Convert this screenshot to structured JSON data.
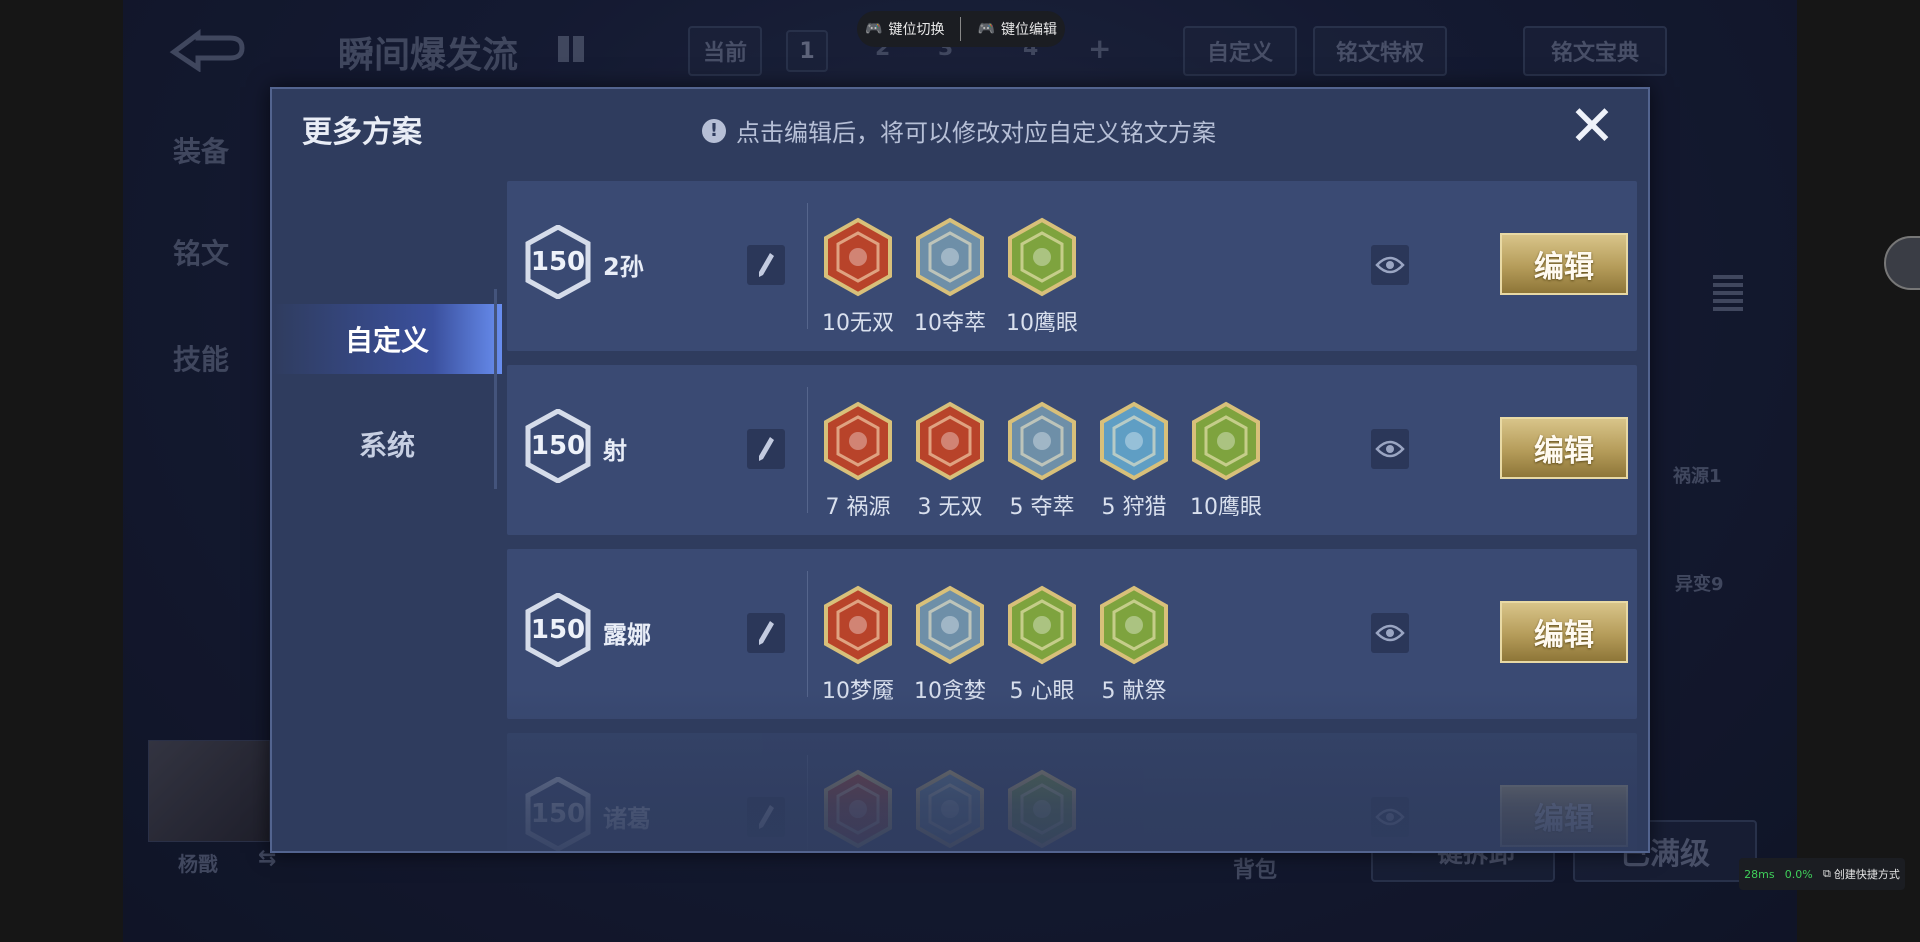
{
  "overlay_toolbar": {
    "key_switch": "键位切换",
    "key_edit": "键位编辑"
  },
  "background": {
    "plan_title": "瞬间爆发流",
    "current_label": "当前",
    "pages": [
      "1",
      "2",
      "3",
      "4"
    ],
    "add": "+",
    "custom_tab": "自定义",
    "rune_privilege": "铭文特权",
    "rune_codex": "铭文宝典",
    "side_menu": [
      "装备",
      "铭文",
      "技能"
    ],
    "hero_name": "杨戬",
    "right_badges": [
      "祸源1",
      "异变9"
    ],
    "bag": "背包",
    "max_level_btn": "已满级",
    "one_key_btn": "一键拆卸"
  },
  "modal": {
    "title": "更多方案",
    "hint": "点击编辑后，将可以修改对应自定义铭文方案",
    "close_glyph": "✕",
    "tabs": [
      {
        "label": "自定义",
        "active": true
      },
      {
        "label": "系统",
        "active": false
      }
    ],
    "edit_label": "编辑",
    "plans": [
      {
        "level": "150",
        "name": "2孙",
        "runes": [
          {
            "label": "10无双",
            "color": "#b8432a"
          },
          {
            "label": "10夺萃",
            "color": "#6e8fa8"
          },
          {
            "label": "10鹰眼",
            "color": "#7ea33e"
          }
        ]
      },
      {
        "level": "150",
        "name": "射",
        "runes": [
          {
            "label": "7 祸源",
            "color": "#b8432a"
          },
          {
            "label": "3 无双",
            "color": "#b8432a"
          },
          {
            "label": "5 夺萃",
            "color": "#6e8fa8"
          },
          {
            "label": "5 狩猎",
            "color": "#5f9ec4"
          },
          {
            "label": "10鹰眼",
            "color": "#7ea33e"
          }
        ]
      },
      {
        "level": "150",
        "name": "露娜",
        "runes": [
          {
            "label": "10梦魇",
            "color": "#b8432a"
          },
          {
            "label": "10贪婪",
            "color": "#6e8fa8"
          },
          {
            "label": "5 心眼",
            "color": "#7ea33e"
          },
          {
            "label": "5 献祭",
            "color": "#7ea33e"
          }
        ]
      },
      {
        "level": "150",
        "name": "诸葛",
        "runes": [
          {
            "label": "",
            "color": "#b8432a"
          },
          {
            "label": "",
            "color": "#6e8fa8"
          },
          {
            "label": "",
            "color": "#7ea33e"
          }
        ]
      }
    ]
  },
  "status_widget": {
    "latency": "28ms",
    "loss": "0.0%",
    "shortcut": "创建快捷方式"
  }
}
